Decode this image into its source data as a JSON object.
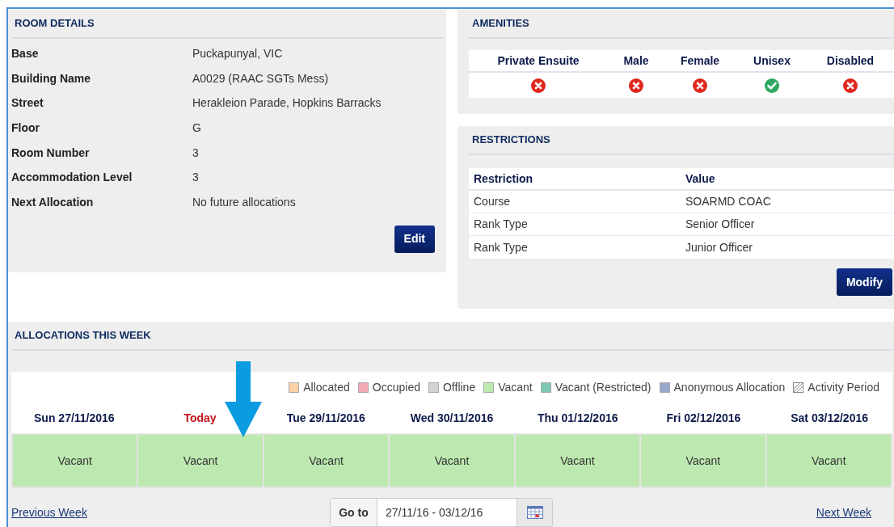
{
  "room_details": {
    "title": "ROOM DETAILS",
    "fields": [
      {
        "label": "Base",
        "value": "Puckapunyal, VIC"
      },
      {
        "label": "Building Name",
        "value": "A0029 (RAAC SGTs Mess)"
      },
      {
        "label": "Street",
        "value": "Herakleion Parade, Hopkins Barracks"
      },
      {
        "label": "Floor",
        "value": "G"
      },
      {
        "label": "Room Number",
        "value": "3"
      },
      {
        "label": "Accommodation Level",
        "value": "3"
      },
      {
        "label": "Next Allocation",
        "value": "No future allocations"
      }
    ],
    "button": "Edit"
  },
  "amenities": {
    "title": "AMENITIES",
    "items": [
      {
        "label": "Private Ensuite",
        "available": false
      },
      {
        "label": "Male",
        "available": false
      },
      {
        "label": "Female",
        "available": false
      },
      {
        "label": "Unisex",
        "available": true
      },
      {
        "label": "Disabled",
        "available": false
      }
    ]
  },
  "restrictions": {
    "title": "RESTRICTIONS",
    "columns": [
      "Restriction",
      "Value"
    ],
    "rows": [
      [
        "Course",
        "SOARMD COAC"
      ],
      [
        "Rank Type",
        "Senior Officer"
      ],
      [
        "Rank Type",
        "Junior Officer"
      ]
    ],
    "button": "Modify"
  },
  "allocations": {
    "title": "ALLOCATIONS THIS WEEK",
    "legend": [
      {
        "label": "Allocated",
        "color": "#fdd0a8",
        "kind": "solid"
      },
      {
        "label": "Occupied",
        "color": "#f4a9b5",
        "kind": "solid"
      },
      {
        "label": "Offline",
        "color": "#d3d3d3",
        "kind": "solid"
      },
      {
        "label": "Vacant",
        "color": "#bde9b0",
        "kind": "solid"
      },
      {
        "label": "Vacant (Restricted)",
        "color": "#7fc8b4",
        "kind": "solid"
      },
      {
        "label": "Anonymous Allocation",
        "color": "#98a9cc",
        "kind": "solid"
      },
      {
        "label": "Activity Period",
        "kind": "hatched"
      }
    ],
    "days": [
      {
        "label": "Sun 27/11/2016",
        "today": false,
        "status": "Vacant",
        "color": "#bde9b0"
      },
      {
        "label": "Today",
        "today": true,
        "status": "Vacant",
        "color": "#bde9b0"
      },
      {
        "label": "Tue 29/11/2016",
        "today": false,
        "status": "Vacant",
        "color": "#bde9b0"
      },
      {
        "label": "Wed 30/11/2016",
        "today": false,
        "status": "Vacant",
        "color": "#bde9b0"
      },
      {
        "label": "Thu 01/12/2016",
        "today": false,
        "status": "Vacant",
        "color": "#bde9b0"
      },
      {
        "label": "Fri 02/12/2016",
        "today": false,
        "status": "Vacant",
        "color": "#bde9b0"
      },
      {
        "label": "Sat 03/12/2016",
        "today": false,
        "status": "Vacant",
        "color": "#bde9b0"
      }
    ],
    "previous_link": "Previous Week",
    "goto_label": "Go to",
    "date_range": "27/11/16 - 03/12/16",
    "next_link": "Next Week"
  }
}
